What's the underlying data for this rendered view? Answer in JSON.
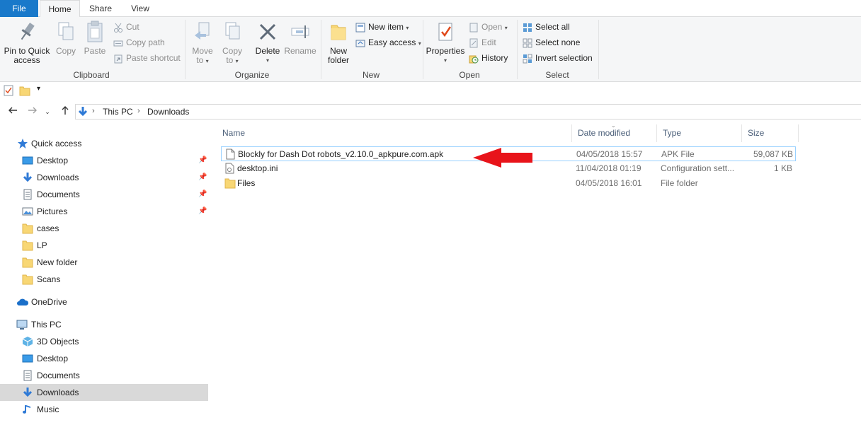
{
  "tabs": {
    "file": "File",
    "home": "Home",
    "share": "Share",
    "view": "View"
  },
  "ribbon": {
    "clipboard": {
      "label": "Clipboard",
      "pin_line1": "Pin to Quick",
      "pin_line2": "access",
      "copy": "Copy",
      "paste": "Paste",
      "cut": "Cut",
      "copy_path": "Copy path",
      "paste_shortcut": "Paste shortcut"
    },
    "organize": {
      "label": "Organize",
      "move_line1": "Move",
      "move_line2": "to",
      "copy_line1": "Copy",
      "copy_line2": "to",
      "delete": "Delete",
      "rename": "Rename"
    },
    "new": {
      "label": "New",
      "folder_line1": "New",
      "folder_line2": "folder",
      "new_item": "New item",
      "easy_access": "Easy access"
    },
    "open": {
      "label": "Open",
      "properties": "Properties",
      "open": "Open",
      "edit": "Edit",
      "history": "History"
    },
    "select": {
      "label": "Select",
      "select_all": "Select all",
      "select_none": "Select none",
      "invert": "Invert selection"
    }
  },
  "address": {
    "crumbs": [
      "This PC",
      "Downloads"
    ]
  },
  "nav": {
    "quick_access": "Quick access",
    "quick_items": [
      {
        "label": "Desktop",
        "icon": "desktop-icon",
        "pinned": true
      },
      {
        "label": "Downloads",
        "icon": "download-arrow-icon",
        "pinned": true
      },
      {
        "label": "Documents",
        "icon": "documents-icon",
        "pinned": true
      },
      {
        "label": "Pictures",
        "icon": "pictures-icon",
        "pinned": true
      },
      {
        "label": "cases",
        "icon": "folder-icon",
        "pinned": false
      },
      {
        "label": "LP",
        "icon": "folder-icon",
        "pinned": false
      },
      {
        "label": "New folder",
        "icon": "folder-icon",
        "pinned": false
      },
      {
        "label": "Scans",
        "icon": "folder-icon",
        "pinned": false
      }
    ],
    "onedrive": "OneDrive",
    "this_pc": "This PC",
    "pc_items": [
      {
        "label": "3D Objects",
        "icon": "3d-objects-icon"
      },
      {
        "label": "Desktop",
        "icon": "desktop-icon"
      },
      {
        "label": "Documents",
        "icon": "documents-icon"
      },
      {
        "label": "Downloads",
        "icon": "download-arrow-icon",
        "selected": true
      },
      {
        "label": "Music",
        "icon": "music-icon"
      }
    ]
  },
  "columns": {
    "name": "Name",
    "date": "Date modified",
    "type": "Type",
    "size": "Size"
  },
  "files": [
    {
      "name": "Blockly for Dash Dot robots_v2.10.0_apkpure.com.apk",
      "date": "04/05/2018 15:57",
      "type": "APK File",
      "size": "59,087 KB",
      "icon": "file-icon",
      "selected": true
    },
    {
      "name": "desktop.ini",
      "date": "11/04/2018 01:19",
      "type": "Configuration sett...",
      "size": "1 KB",
      "icon": "settings-file-icon"
    },
    {
      "name": "Files",
      "date": "04/05/2018 16:01",
      "type": "File folder",
      "size": "",
      "icon": "folder-icon"
    }
  ],
  "annotation": {
    "arrow_color": "#e8141a"
  },
  "colors": {
    "accent": "#1979ca",
    "folder": "#f8d775",
    "selection": "#99d1ff"
  }
}
